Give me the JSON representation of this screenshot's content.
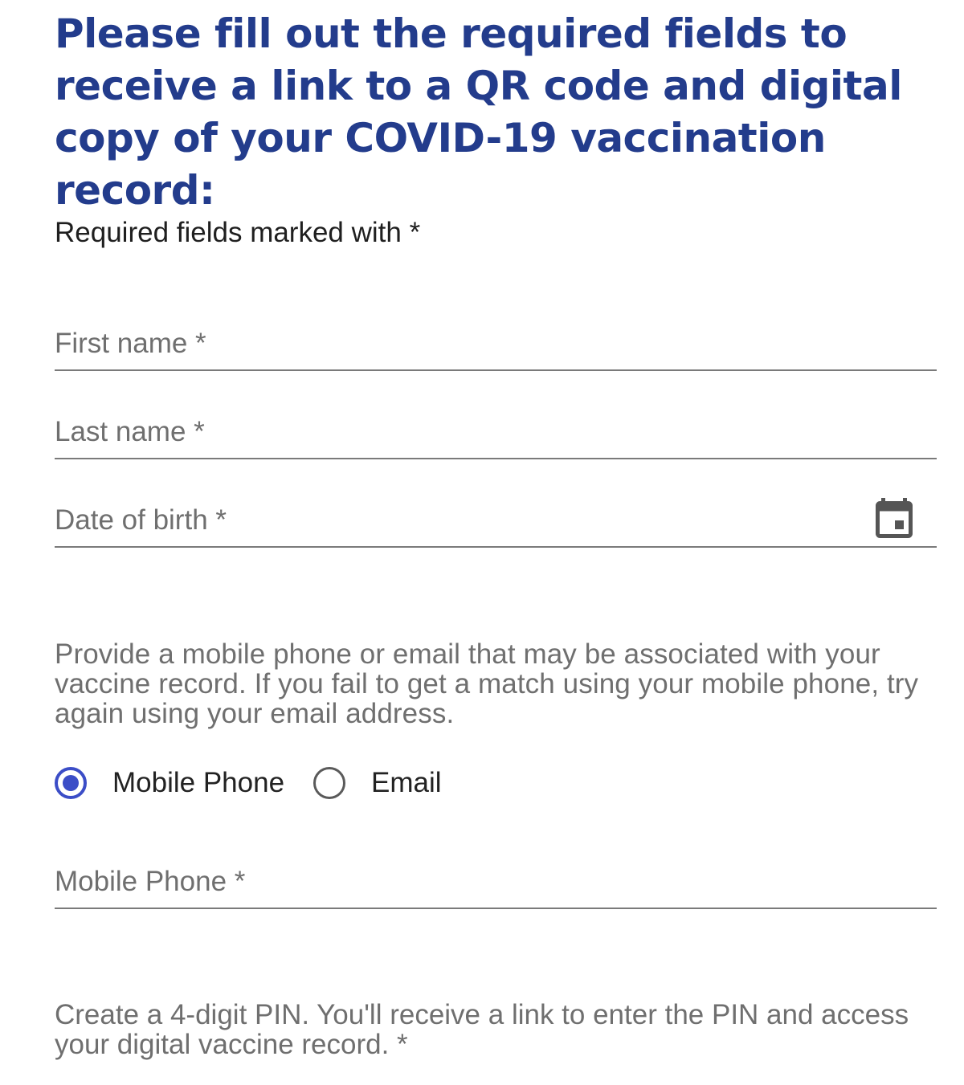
{
  "form": {
    "heading": "Please fill out the required fields to receive a link to a QR code and digital copy of your COVID-19 vaccination record:",
    "required_note": "Required fields marked with *",
    "fields": {
      "first_name": {
        "label": "First name *",
        "value": ""
      },
      "last_name": {
        "label": "Last name *",
        "value": ""
      },
      "date_of_birth": {
        "label": "Date of birth *",
        "value": "",
        "icon": "calendar-icon"
      },
      "mobile_phone": {
        "label": "Mobile Phone *",
        "value": ""
      }
    },
    "contact_note": "Provide a mobile phone or email that may be associated with your vaccine record. If you fail to get a match using your mobile phone, try again using your email address.",
    "contact_method": {
      "options": [
        {
          "label": "Mobile Phone",
          "selected": true
        },
        {
          "label": "Email",
          "selected": false
        }
      ]
    },
    "pin_note": "Create a 4-digit PIN. You'll receive a link to enter the PIN and access your digital vaccine record. *"
  },
  "colors": {
    "heading": "#233c8c",
    "radio_selected": "#3b4dc7",
    "field_label": "#6f6f6f",
    "underline": "#7a7a7a"
  }
}
